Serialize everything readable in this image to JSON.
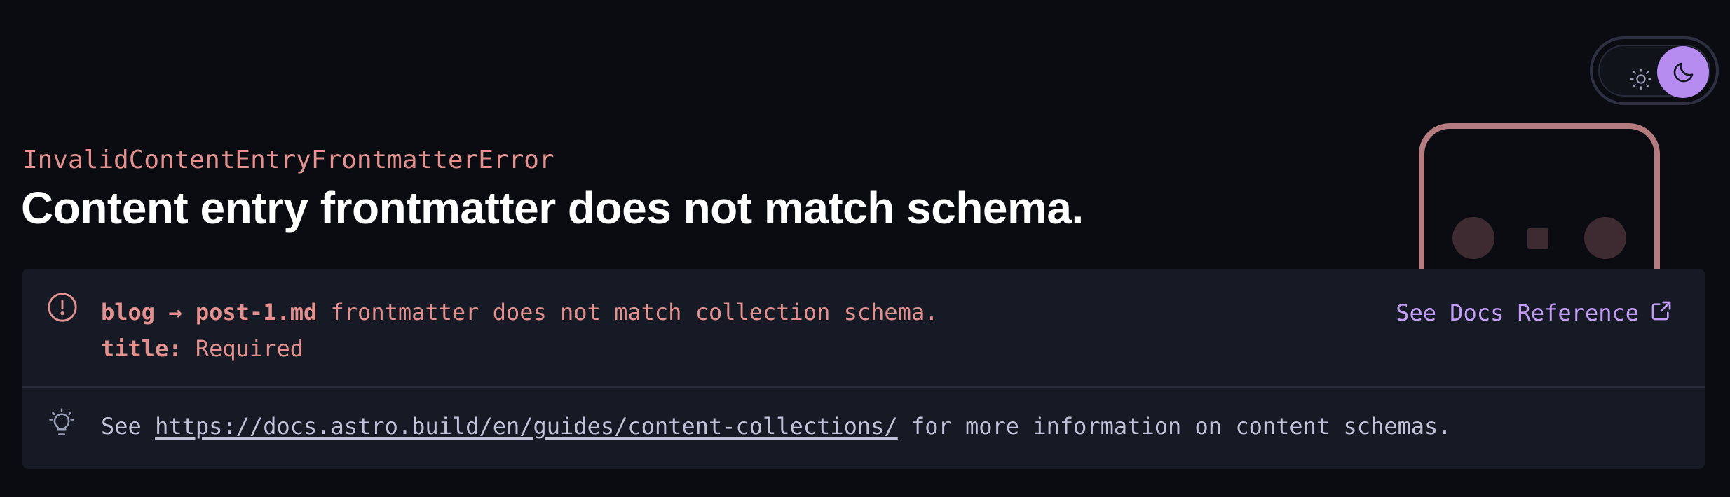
{
  "theme_toggle": {
    "icons": [
      "sun-icon",
      "moon-icon"
    ],
    "active": "dark",
    "accent_color": "#b68cf0"
  },
  "error": {
    "name": "InvalidContentEntryFrontmatterError",
    "title": "Content entry frontmatter does not match schema.",
    "message": {
      "collection": "blog",
      "arrow": "→",
      "file": "post-1.md",
      "text": " frontmatter does not match collection schema.",
      "field": "title:",
      "field_error": " Required"
    },
    "docs_link_label": "See Docs Reference",
    "hint": {
      "prefix": "See ",
      "url": "https://docs.astro.build/en/guides/content-collections/",
      "suffix": " for more information on content schemas."
    }
  },
  "colors": {
    "background": "#0b0c12",
    "panel": "#161a25",
    "error_text": "#e3908e",
    "link": "#c39cf5",
    "hint_text": "#bfc3d8"
  },
  "icons": {
    "alert": "alert-circle-icon",
    "external": "external-link-icon",
    "hint": "lightbulb-icon"
  }
}
